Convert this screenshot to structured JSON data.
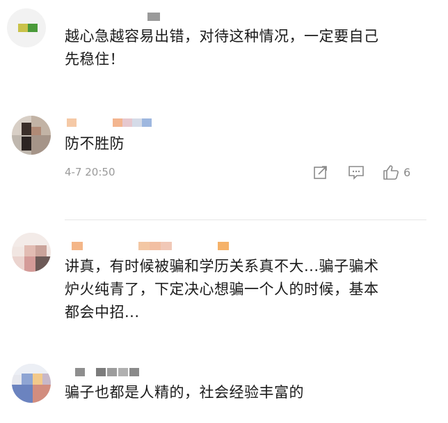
{
  "comments": [
    {
      "text_lines": [
        "越心急越容易出错，对待这种情况，一定要自己",
        "先稳住！"
      ]
    },
    {
      "text_lines": [
        "防不胜防"
      ],
      "time": "4-7 20:50",
      "likes": "6",
      "action_icons": [
        "share-icon",
        "comment-icon",
        "like-icon"
      ]
    },
    {
      "text_lines": [
        "讲真，有时候被骗和学历关系真不大...骗子骗术",
        "炉火纯青了，下定决心想骗一个人的时候，基本",
        "都会中招..."
      ]
    },
    {
      "text_lines": [
        "骗子也都是人精的，社会经验丰富的"
      ]
    }
  ]
}
